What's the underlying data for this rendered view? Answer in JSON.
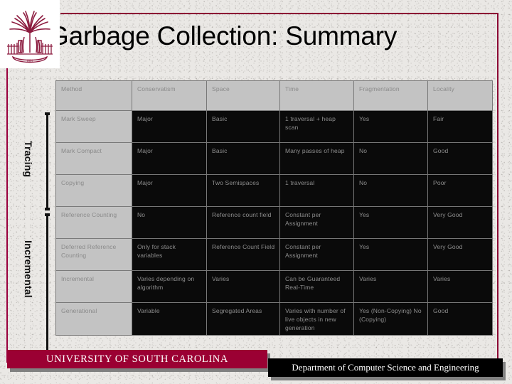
{
  "slide": {
    "title": "Garbage Collection: Summary",
    "logo_alt": "usc-palmetto-logo"
  },
  "groups": {
    "tracing": "Tracing",
    "incremental": "Incremental"
  },
  "table": {
    "headers": [
      "Method",
      "Conservatism",
      "Space",
      "Time",
      "Fragmentation",
      "Locality"
    ],
    "rows": [
      {
        "method": "Mark Sweep",
        "conservatism": "Major",
        "space": "Basic",
        "time": "1 traversal + heap scan",
        "fragmentation": "Yes",
        "locality": "Fair"
      },
      {
        "method": "Mark Compact",
        "conservatism": "Major",
        "space": "Basic",
        "time": "Many passes of heap",
        "fragmentation": "No",
        "locality": "Good"
      },
      {
        "method": "Copying",
        "conservatism": "Major",
        "space": "Two Semispaces",
        "time": "1 traversal",
        "fragmentation": "No",
        "locality": "Poor"
      },
      {
        "method": "Reference Counting",
        "conservatism": "No",
        "space": "Reference count field",
        "time": "Constant per Assignment",
        "fragmentation": "Yes",
        "locality": "Very Good"
      },
      {
        "method": "Deferred Reference Counting",
        "conservatism": "Only for stack variables",
        "space": "Reference Count Field",
        "time": "Constant per Assignment",
        "fragmentation": "Yes",
        "locality": "Very Good"
      },
      {
        "method": "Incremental",
        "conservatism": "Varies depending on algorithm",
        "space": "Varies",
        "time": "Can be Guaranteed Real-Time",
        "fragmentation": "Varies",
        "locality": "Varies"
      },
      {
        "method": "Generational",
        "conservatism": "Variable",
        "space": "Segregated Areas",
        "time": "Varies with number of live objects in new generation",
        "fragmentation": "Yes (Non-Copying) No (Copying)",
        "locality": "Good"
      }
    ]
  },
  "footer": {
    "university": "UNIVERSITY OF SOUTH CAROLINA",
    "department": "Department of Computer Science and Engineering"
  },
  "colors": {
    "maroon": "#9b0033",
    "frame": "#8c0034",
    "cell_dark": "#0a0a0a",
    "cell_light": "#c3c3c3",
    "cell_text": "#8e8e8e"
  }
}
